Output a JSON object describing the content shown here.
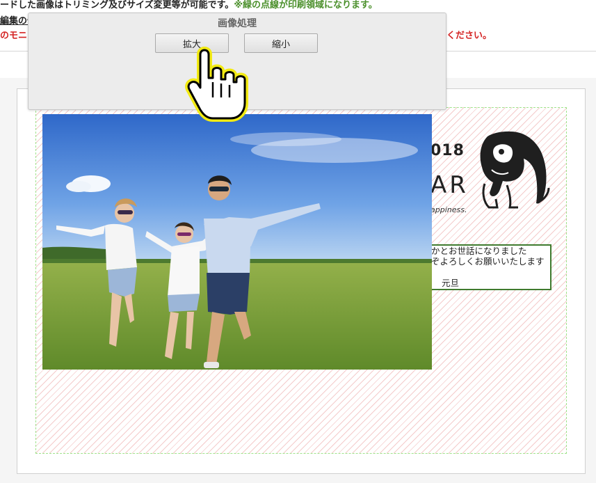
{
  "header": {
    "line1_black": "ードした画像はトリミング及びサイズ変更等が可能です。",
    "line1_green": "※緑の点線が印刷領域になります。",
    "line2": "編集の便",
    "line3_left": "のモニ",
    "line3_right": "ください。"
  },
  "colors": {
    "guide_green": "#9ee38a",
    "notice_red": "#d42323",
    "message_border": "#3f7a2e"
  },
  "card": {
    "year": "018",
    "ar": "AR",
    "happiness": "appiness.",
    "message": {
      "line1": "かとお世話になりました",
      "line2": "ぞよろしくお願いいたします",
      "line3": "元旦"
    }
  },
  "dialog": {
    "title": "画像処理",
    "enlarge_label": "拡大",
    "shrink_label": "縮小"
  },
  "icons": {
    "cursor": "hand-pointer-icon",
    "mascot": "bulldog-illustration"
  }
}
